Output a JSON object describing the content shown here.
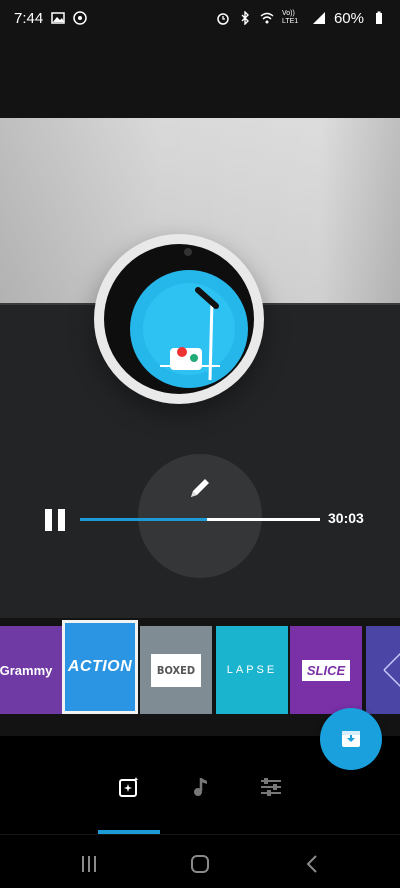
{
  "status_bar": {
    "time": "7:44",
    "battery": "60%",
    "network_label": "Vo)) LTE1"
  },
  "player": {
    "elapsed_fraction": 0.53,
    "duration": "30:03"
  },
  "themes": [
    {
      "label": "Grammy"
    },
    {
      "label": "ACTION",
      "selected": true
    },
    {
      "label": "BOXED"
    },
    {
      "label": "LAPSE"
    },
    {
      "label": "SLICE"
    }
  ],
  "toolbar": {
    "items": [
      "themes-icon",
      "music-icon",
      "adjust-icon"
    ],
    "active_index": 0
  },
  "colors": {
    "accent": "#1d9bd6",
    "fab": "#1aa0dd",
    "action_tile": "#2b95e3",
    "grammy_tile": "#6f3aa3"
  }
}
